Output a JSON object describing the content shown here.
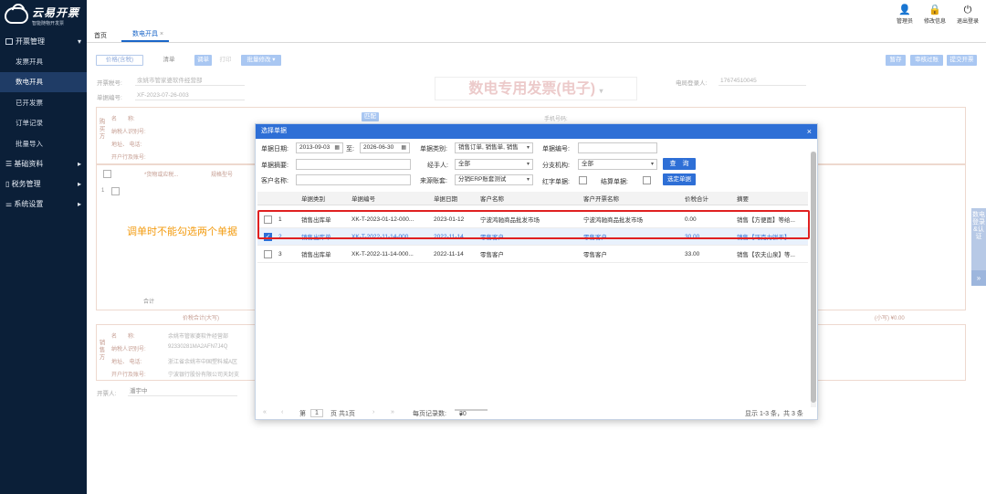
{
  "app": {
    "logo_title": "云易开票",
    "logo_sub": "智能随物开发票"
  },
  "sidebar": {
    "groups": [
      {
        "label": "开票管理",
        "items": [
          "发票开具",
          "数电开具",
          "已开发票",
          "订单记录",
          "批量导入"
        ]
      },
      {
        "label": "基础资料"
      },
      {
        "label": "税务管理"
      },
      {
        "label": "系统设置"
      }
    ]
  },
  "topbar": {
    "admin": "管理员",
    "info": "修改信息",
    "logout": "退出登录"
  },
  "tabs": {
    "home": "首页",
    "current": "数电开具",
    "close": "×"
  },
  "toolbar": {
    "price_mode": "价格(含税)",
    "list": "清单",
    "adjust": "调单",
    "print": "打印",
    "batch": "批量修改 ▾",
    "save": "暂存",
    "check": "审核过账",
    "submit": "提交开票"
  },
  "form": {
    "tax_no_label": "开票税号:",
    "tax_no_value": "余姚市管家婆软件经营部",
    "doc_no_label": "单据编号:",
    "doc_no_value": "XF-2023-07-26-003",
    "title": "数电专用发票(电子)",
    "login_label": "电局登录人:",
    "login_value": "17674510045",
    "buyer_vert": "购买方",
    "name_label": "名　　称:",
    "taxid_label": "纳税人识别号:",
    "addr_label": "地址、 电话:",
    "bank_label": "开户行及账号:",
    "match_btn": "匹配",
    "phone_label": "手机号码:",
    "goods_col": "*货物或应税...",
    "spec_col": "规格型号",
    "total_label": "合计",
    "amount_words": "价税合计(大写)",
    "amount_small": "(小写) ¥0.00",
    "seller_vert": "销售方",
    "seller_name": "余姚市管家婆软件经营部",
    "seller_taxid": "92330281MA2AFN7J4Q",
    "seller_addr": "浙江省余姚市中国塑料城A区",
    "seller_bank": "宁波银行股份有限公司天封支",
    "drawer_label": "开票人:",
    "drawer_value": "潘宇中"
  },
  "annotation": "调单时不能勾选两个单据",
  "side_tab": {
    "label": "数电登录&认证",
    "arrow": "»"
  },
  "dialog": {
    "title": "选择单据",
    "close": "×",
    "date_label": "单据日期:",
    "date_from": "2013-09-03",
    "date_to_label": "至:",
    "date_to": "2026-06-30",
    "type_label": "单据类别:",
    "type_value": "销售订单, 销售单, 销售",
    "docno_label": "单据编号:",
    "docno_value": "",
    "summary_label": "单据摘要:",
    "summary_value": "",
    "handler_label": "经手人:",
    "handler_value": "全部",
    "branch_label": "分支机构:",
    "branch_value": "全部",
    "query_btn": "查　询",
    "customer_label": "客户名称:",
    "customer_value": "",
    "source_label": "来源账套:",
    "source_value": "分销ERP账套测试",
    "red_label": "红字单据:",
    "settle_label": "结算单据:",
    "select_btn": "选定单据",
    "columns": [
      "单据类别",
      "单据编号",
      "单据日期",
      "客户名称",
      "客户开票名称",
      "价税合计",
      "摘要"
    ],
    "rows": [
      {
        "no": "1",
        "type": "销售出库单",
        "code": "XK-T-2023-01-12-000...",
        "date": "2023-01-12",
        "customer": "宁波鸿驰商品批发市场",
        "invoice_name": "宁波鸿驰商品批发市场",
        "total": "0.00",
        "summary": "销售【方便面】等给...",
        "checked": false
      },
      {
        "no": "2",
        "type": "销售出库单",
        "code": "XK-T-2022-11-14-000...",
        "date": "2022-11-14",
        "customer": "零售客户",
        "invoice_name": "零售客户",
        "total": "30.00",
        "summary": "销售【巧克力饼干】",
        "checked": true
      },
      {
        "no": "3",
        "type": "销售出库单",
        "code": "XK-T-2022-11-14-000...",
        "date": "2022-11-14",
        "customer": "零售客户",
        "invoice_name": "零售客户",
        "total": "33.00",
        "summary": "销售【农夫山泉】等...",
        "checked": false
      }
    ],
    "pager": {
      "first": "«",
      "prev": "‹",
      "page_label": "第",
      "page": "1",
      "of": "页 共1页",
      "next": "›",
      "last": "»",
      "per_page_label": "每页记录数:",
      "per_page": "30",
      "info": "显示 1-3 条，共 3 条"
    }
  }
}
